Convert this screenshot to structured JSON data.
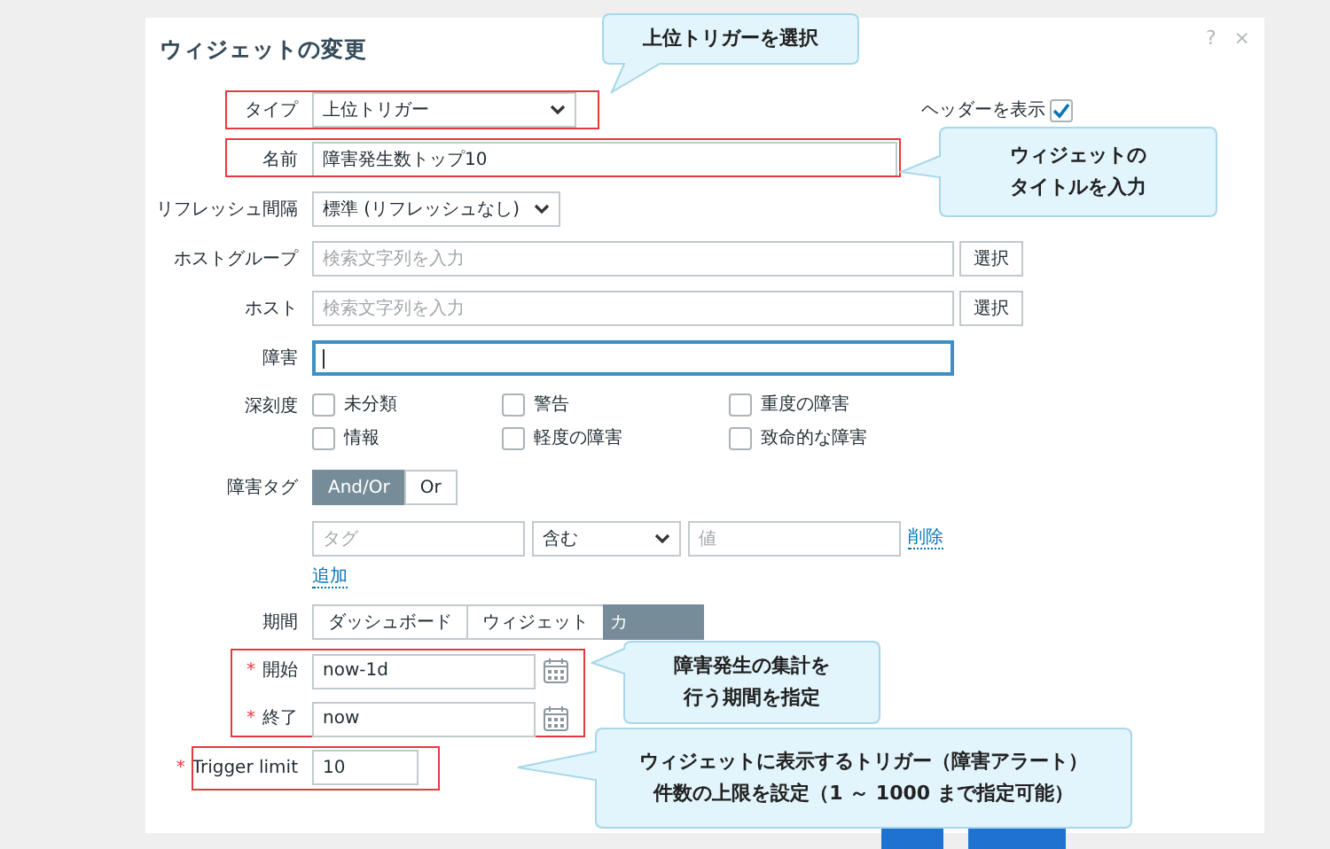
{
  "dialog_title": "ウィジェットの変更",
  "help": "?",
  "close": "×",
  "show_header": {
    "label": "ヘッダーを表示",
    "checked": true
  },
  "type": {
    "label": "タイプ",
    "value": "上位トリガー",
    "highlighted": true
  },
  "name": {
    "label": "名前",
    "value": "障害発生数トップ10",
    "highlighted": true
  },
  "refresh_interval": {
    "label": "リフレッシュ間隔",
    "value": "標準 (リフレッシュなし)"
  },
  "host_groups": {
    "label": "ホストグループ",
    "placeholder": "検索文字列を入力",
    "button": "選択"
  },
  "hosts": {
    "label": "ホスト",
    "placeholder": "検索文字列を入力",
    "button": "選択"
  },
  "problem": {
    "label": "障害",
    "focused": true
  },
  "severity": {
    "label": "深刻度",
    "options": [
      {
        "label": "未分類",
        "checked": false
      },
      {
        "label": "警告",
        "checked": false
      },
      {
        "label": "重度の障害",
        "checked": false
      },
      {
        "label": "情報",
        "checked": false
      },
      {
        "label": "軽度の障害",
        "checked": false
      },
      {
        "label": "致命的な障害",
        "checked": false
      }
    ]
  },
  "problem_tags": {
    "label": "障害タグ",
    "operators": [
      {
        "label": "And/Or",
        "selected": true
      },
      {
        "label": "Or",
        "selected": false
      }
    ],
    "rows": [
      {
        "tag_placeholder": "タグ",
        "operator": "含む",
        "value_placeholder": "値",
        "remove": "削除"
      }
    ],
    "add": "追加"
  },
  "period": {
    "label": "期間",
    "options": [
      {
        "label": "ダッシュボード",
        "selected": false
      },
      {
        "label": "ウィジェット",
        "selected": false
      },
      {
        "label": "カ",
        "selected": true
      }
    ]
  },
  "time_range": {
    "highlighted": true,
    "from": {
      "required_mark": "*",
      "label": "開始",
      "value": "now-1d"
    },
    "to": {
      "required_mark": "*",
      "label": "終了",
      "value": "now"
    }
  },
  "trigger_limit": {
    "required_mark": "*",
    "label": "Trigger limit",
    "value": "10",
    "highlighted": true
  },
  "callouts": [
    {
      "lines": [
        "上位トリガーを選択"
      ]
    },
    {
      "lines": [
        "ウィジェットの",
        "タイトルを入力"
      ]
    },
    {
      "lines": [
        "障害発生の集計を",
        "行う期間を指定"
      ]
    },
    {
      "lines": [
        "ウィジェットに表示するトリガー（障害アラート）",
        "件数の上限を設定（1 ～ 1000 まで指定可能）"
      ]
    }
  ]
}
